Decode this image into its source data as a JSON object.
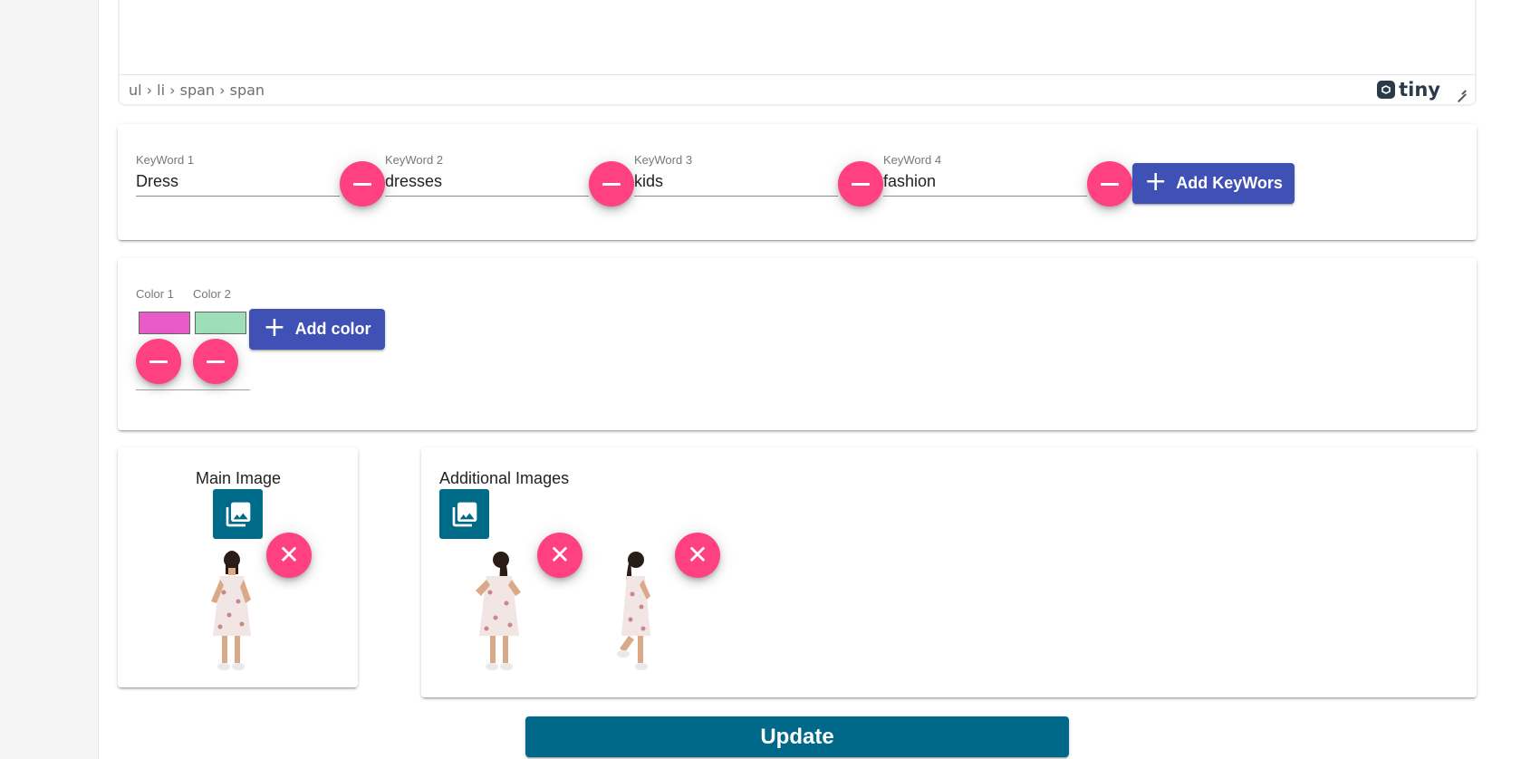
{
  "editor": {
    "element_path": "ul › li › span › span",
    "brand": "tiny"
  },
  "keywords": {
    "items": [
      {
        "label": "KeyWord 1",
        "value": "Dress"
      },
      {
        "label": "KeyWord 2",
        "value": "dresses"
      },
      {
        "label": "KeyWord 3",
        "value": "kids"
      },
      {
        "label": "KeyWord 4",
        "value": "fashion"
      }
    ],
    "add_label": "Add KeyWors"
  },
  "colors": {
    "items": [
      {
        "label": "Color 1",
        "value": "#e85bc8"
      },
      {
        "label": "Color 2",
        "value": "#9edfb9"
      }
    ],
    "add_label": "Add color"
  },
  "main_image": {
    "title": "Main Image"
  },
  "additional_images": {
    "title": "Additional Images"
  },
  "update_label": "Update",
  "colors_accent": {
    "remove": "#ff4081",
    "primary": "#3f51b5",
    "teal": "#00698a"
  }
}
